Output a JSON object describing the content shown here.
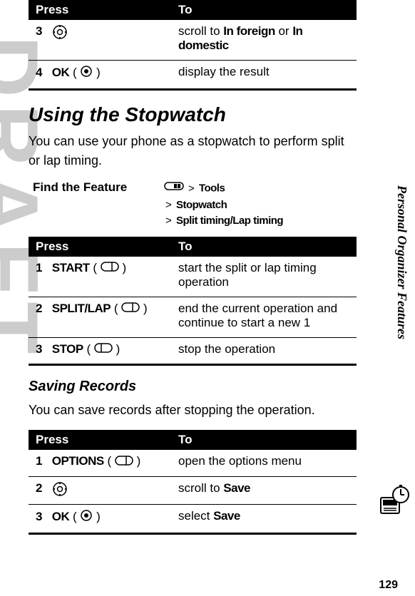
{
  "draft_text": "DRAFT",
  "table1": {
    "head_press": "Press",
    "head_to": "To",
    "rows": [
      {
        "num": "3",
        "to_pre": "scroll to ",
        "to_b1": "In foreign",
        "to_mid": " or ",
        "to_b2": "In domestic"
      },
      {
        "num": "4",
        "label": "OK",
        "to": "display the result"
      }
    ]
  },
  "section_title": "Using the Stopwatch",
  "intro": "You can use your phone as a stopwatch to perform split or lap timing.",
  "find": {
    "label": "Find the Feature",
    "path1": "Tools",
    "path2": "Stopwatch",
    "path3": "Split timing/Lap timing",
    "gt": ">"
  },
  "table2": {
    "head_press": "Press",
    "head_to": "To",
    "rows": [
      {
        "num": "1",
        "label": "START",
        "to": "start the split or lap timing operation"
      },
      {
        "num": "2",
        "label": "SPLIT/LAP",
        "to": "end the current operation and continue to start a new 1"
      },
      {
        "num": "3",
        "label": "STOP",
        "to": "stop the operation"
      }
    ]
  },
  "sub_title": "Saving Records",
  "sub_intro": "You can save records after stopping the operation.",
  "table3": {
    "head_press": "Press",
    "head_to": "To",
    "rows": [
      {
        "num": "1",
        "label": "OPTIONS",
        "to": "open the options menu"
      },
      {
        "num": "2",
        "to_pre": "scroll to ",
        "to_b1": "Save"
      },
      {
        "num": "3",
        "label": "OK",
        "to_pre": "select ",
        "to_b1": "Save"
      }
    ]
  },
  "side_label": "Personal Organizer Features",
  "page_number": "129"
}
